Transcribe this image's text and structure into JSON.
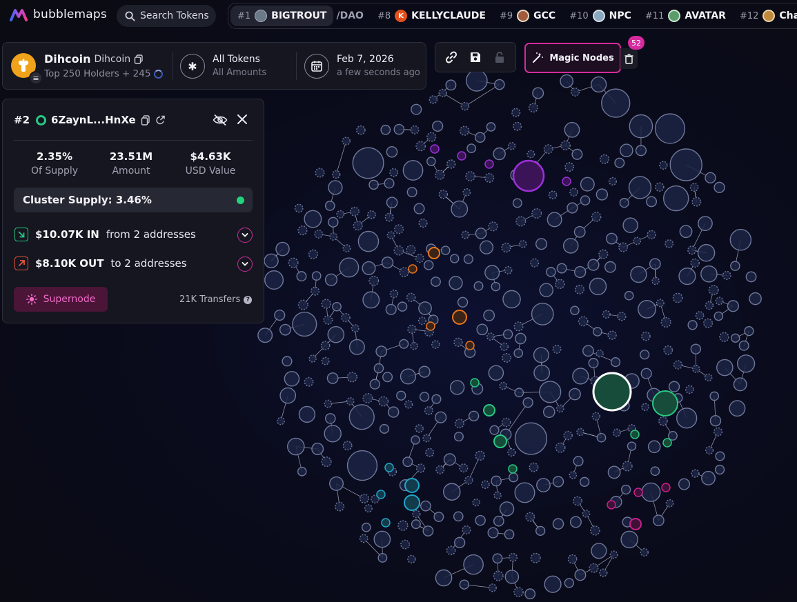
{
  "brand": {
    "name": "bubblemaps"
  },
  "search": {
    "label": "Search Tokens"
  },
  "ticker": [
    {
      "rank": "#1",
      "name": "BIGTROUT",
      "icon": "trout-icon",
      "color": "#6b7a88"
    },
    {
      "rank": "",
      "name": "/DAO",
      "icon": "",
      "color": ""
    },
    {
      "rank": "#8",
      "name": "KELLYCLAUDE",
      "icon": "k-icon",
      "color": "#e5501d"
    },
    {
      "rank": "#9",
      "name": "GCC",
      "icon": "gcc-icon",
      "color": "#a25b3c"
    },
    {
      "rank": "#10",
      "name": "NPC",
      "icon": "npc-icon",
      "color": "#8aa9c0"
    },
    {
      "rank": "#11",
      "name": "AVATAR",
      "icon": "avatar-icon",
      "color": "#5a9c6a"
    },
    {
      "rank": "#12",
      "name": "Chariz",
      "icon": "chariz-icon",
      "color": "#c08a3c"
    }
  ],
  "token": {
    "name": "Dihcoin",
    "symbol": "Dihcoin",
    "holders_text": "Top 250 Holders + 245",
    "filter_main": "All Tokens",
    "filter_sub": "All Amounts",
    "date": "Feb 7, 2026",
    "date_sub": "a few seconds ago"
  },
  "toolbar": {
    "magic_label": "Magic Nodes",
    "magic_count": "52"
  },
  "detail": {
    "rank": "#2",
    "address": "6ZaynL...HnXe",
    "supply_pct": "2.35%",
    "supply_label": "Of Supply",
    "amount": "23.51M",
    "amount_label": "Amount",
    "usd": "$4.63K",
    "usd_label": "USD Value",
    "cluster": "Cluster Supply: 3.46%",
    "in_value": "$10.07K IN",
    "in_desc": "from 2 addresses",
    "out_value": "$8.10K OUT",
    "out_desc": "to 2 addresses",
    "supernode": "Supernode",
    "transfers": "21K Transfers"
  },
  "colors": {
    "accent": "#d42b9c",
    "green": "#27c982",
    "orange": "#e8761c",
    "purple": "#9b2fd6",
    "cyan": "#1fa8c9",
    "pink": "#cc1f8f"
  }
}
